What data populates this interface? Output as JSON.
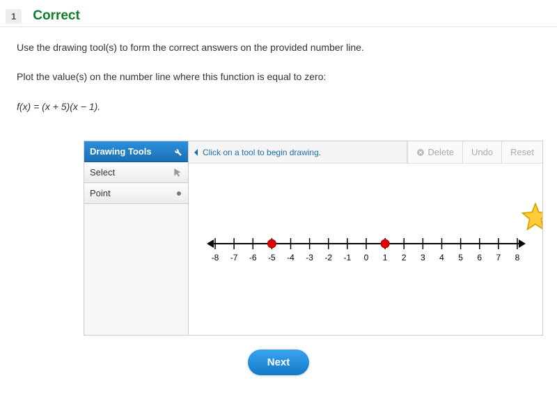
{
  "question": {
    "number": "1",
    "status": "Correct",
    "prompt1": "Use the drawing tool(s) to form the correct answers on the provided number line.",
    "prompt2": "Plot the value(s) on the number line where this function is equal to zero:",
    "equation": "f(x) = (x + 5)(x − 1)."
  },
  "toolbox": {
    "header": "Drawing Tools",
    "tools": {
      "select": "Select",
      "point": "Point"
    },
    "hint": "Click on a tool to begin drawing.",
    "buttons": {
      "delete": "Delete",
      "undo": "Undo",
      "reset": "Reset"
    }
  },
  "numberLine": {
    "min": -8,
    "max": 8,
    "ticks": [
      "-8",
      "-7",
      "-6",
      "-5",
      "-4",
      "-3",
      "-2",
      "-1",
      "0",
      "1",
      "2",
      "3",
      "4",
      "5",
      "6",
      "7",
      "8"
    ],
    "points": [
      -5,
      1
    ]
  },
  "nextLabel": "Next"
}
